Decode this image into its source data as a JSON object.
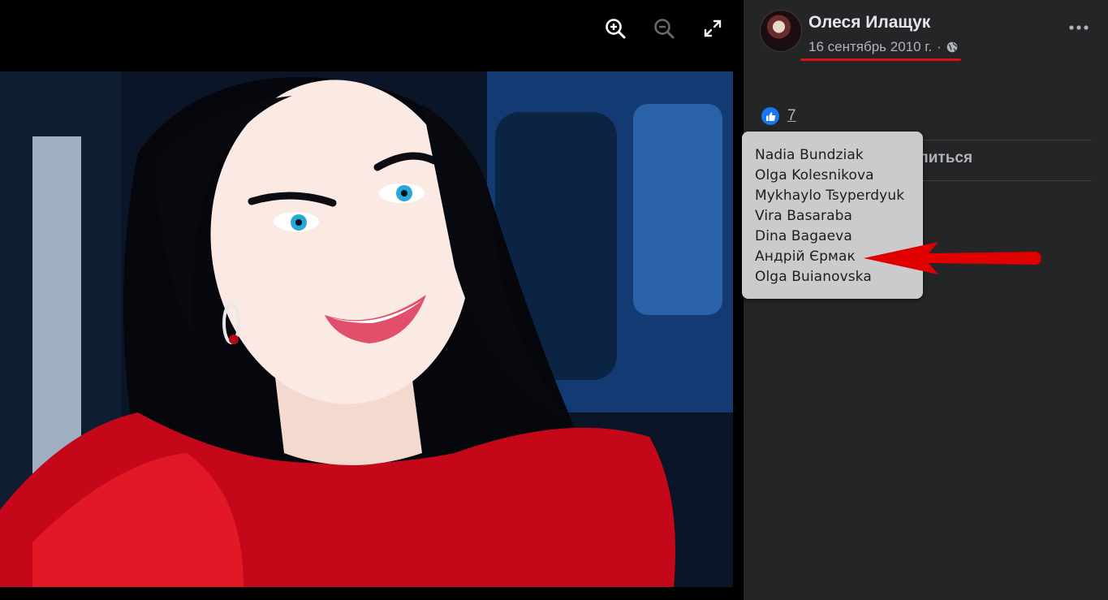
{
  "viewer": {
    "zoom_in_icon": "zoom-in-icon",
    "zoom_out_icon": "zoom-out-icon",
    "fullscreen_icon": "fullscreen-icon"
  },
  "post": {
    "author": "Олеся Илащук",
    "date": "16 сентябрь 2010 г.",
    "separator": "·",
    "privacy_icon": "globe-icon",
    "more_icon": "more-dots-icon"
  },
  "reactions": {
    "icon": "thumbs-up-icon",
    "count": "7",
    "liked_by": [
      "Nadia Bundziak",
      "Olga Kolesnikova",
      "Mykhaylo Tsyperdyuk",
      "Vira Basaraba",
      "Dina Bagaeva",
      "Андрій Єрмак",
      "Olga Buianovska"
    ]
  },
  "actions": {
    "share_label": "Поделиться",
    "share_icon": "share-arrow-icon"
  },
  "colors": {
    "sidebar_bg": "#242526",
    "like_blue": "#1877f2",
    "annotation_red": "#e00000",
    "tooltip_bg": "#cbcbcb"
  }
}
